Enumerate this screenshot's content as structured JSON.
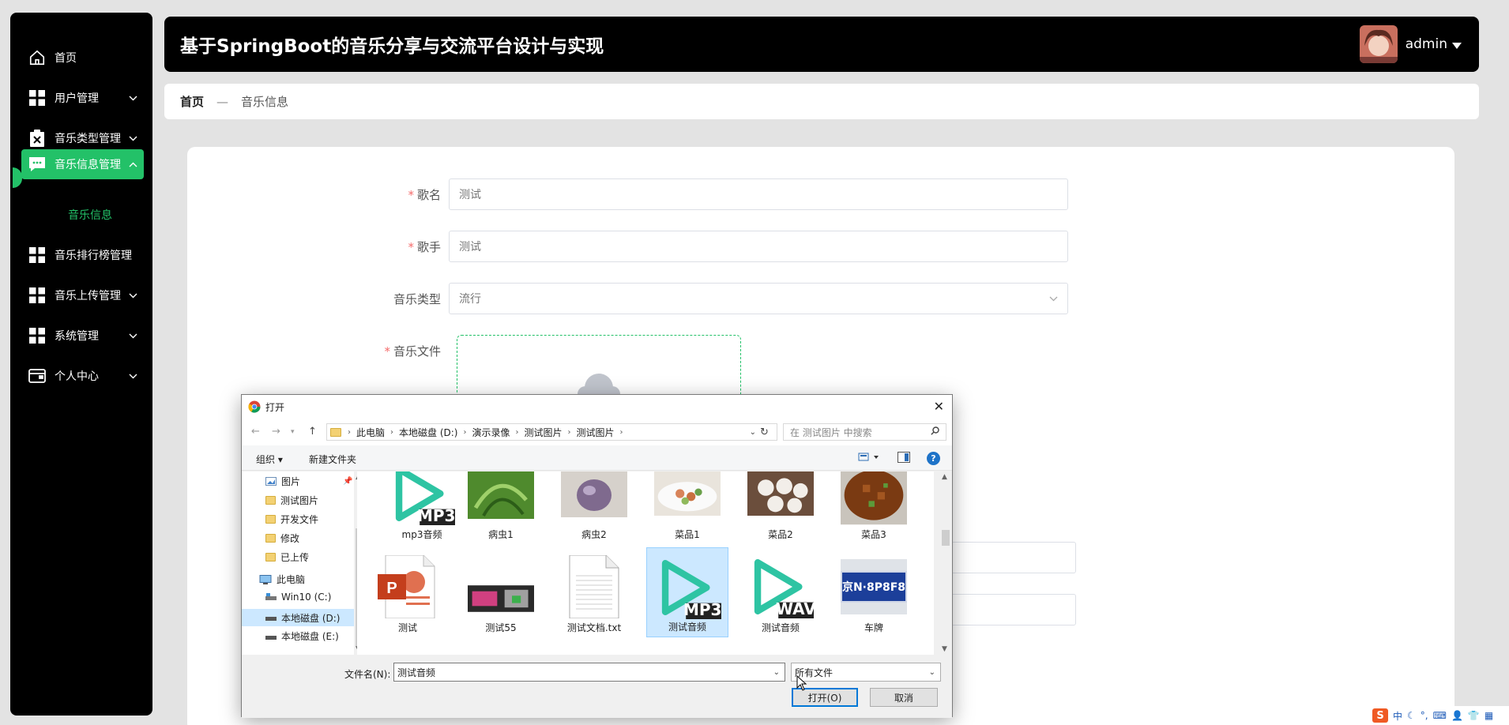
{
  "sidebar": {
    "items": [
      {
        "label": "首页",
        "icon": "home-icon"
      },
      {
        "label": "用户管理",
        "icon": "grid-icon"
      },
      {
        "label": "音乐类型管理",
        "icon": "clipboard-icon"
      },
      {
        "label": "音乐信息管理",
        "icon": "chat-icon"
      },
      {
        "label": "音乐排行榜管理",
        "icon": "grid-icon"
      },
      {
        "label": "音乐上传管理",
        "icon": "grid-icon"
      },
      {
        "label": "系统管理",
        "icon": "grid-icon"
      },
      {
        "label": "个人中心",
        "icon": "wallet-icon"
      }
    ],
    "sub_item": "音乐信息",
    "accent": "#23c168"
  },
  "header": {
    "title": "基于SpringBoot的音乐分享与交流平台设计与实现",
    "user": "admin"
  },
  "breadcrumb": {
    "home": "首页",
    "separator": "—",
    "current": "音乐信息"
  },
  "form": {
    "song_name": {
      "label": "歌名",
      "value": "测试"
    },
    "singer": {
      "label": "歌手",
      "value": "测试"
    },
    "music_type": {
      "label": "音乐类型",
      "value": "流行"
    },
    "music_file": {
      "label": "音乐文件"
    },
    "required_mark": "*"
  },
  "dialog": {
    "title": "打开",
    "close": "✕",
    "path": [
      "此电脑",
      "本地磁盘 (D:)",
      "演示录像",
      "测试图片",
      "测试图片"
    ],
    "search_placeholder": "在 测试图片 中搜索",
    "toolbar": {
      "organize": "组织 ▾",
      "new_folder": "新建文件夹",
      "help": "?"
    },
    "tree": [
      {
        "label": "图片",
        "type": "pictures"
      },
      {
        "label": "测试图片",
        "type": "folder"
      },
      {
        "label": "开发文件",
        "type": "folder"
      },
      {
        "label": "修改",
        "type": "folder"
      },
      {
        "label": "已上传",
        "type": "folder"
      },
      {
        "label": "此电脑",
        "type": "pc"
      },
      {
        "label": "Win10 (C:)",
        "type": "drive"
      },
      {
        "label": "本地磁盘 (D:)",
        "type": "drive"
      },
      {
        "label": "本地磁盘 (E:)",
        "type": "drive"
      }
    ],
    "files": [
      {
        "name": "mp3音频",
        "kind": "media",
        "badge": "MP3"
      },
      {
        "name": "病虫1",
        "kind": "photo",
        "color": "#4f8a2d"
      },
      {
        "name": "病虫2",
        "kind": "photo",
        "color": "#7f6a8e"
      },
      {
        "name": "菜品1",
        "kind": "photo",
        "color": "#c9a27a"
      },
      {
        "name": "菜品2",
        "kind": "photo",
        "color": "#b39a86"
      },
      {
        "name": "菜品3",
        "kind": "photo",
        "color": "#7a3a12"
      },
      {
        "name": "测试",
        "kind": "ppt"
      },
      {
        "name": "测试55",
        "kind": "photo",
        "color": "#3a3a3a"
      },
      {
        "name": "测试文档.txt",
        "kind": "txt"
      },
      {
        "name": "测试音频",
        "kind": "media",
        "badge": "MP3"
      },
      {
        "name": "测试音频",
        "kind": "media",
        "badge": "WAV"
      },
      {
        "name": "车牌",
        "kind": "plate",
        "plate": "京N·8P8F8"
      }
    ],
    "filename_label": "文件名(N):",
    "filename_value": "测试音频",
    "filetype": "所有文件",
    "open_button": "打开(O)",
    "cancel_button": "取消"
  },
  "ime": {
    "lang": "中"
  }
}
